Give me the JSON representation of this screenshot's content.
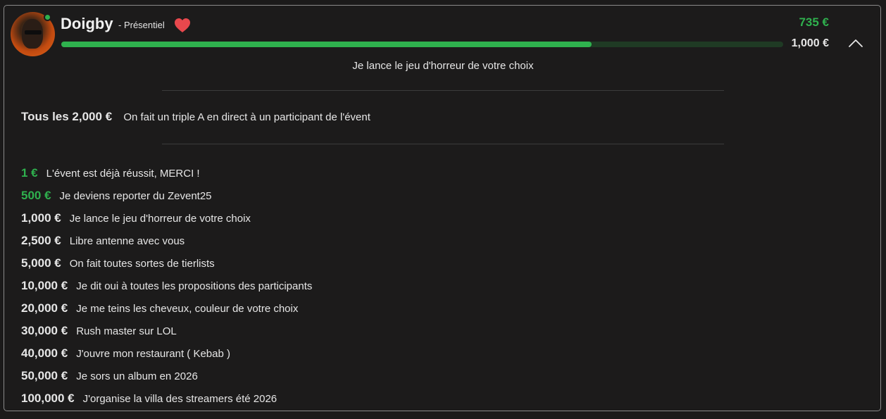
{
  "streamer": {
    "name": "Doigby",
    "mode": "- Présentiel",
    "status": "online",
    "heart_icon": "heart-icon"
  },
  "donation": {
    "raised": "735 €",
    "goal": "1,000 €",
    "progress_fraction": 0.735,
    "next_goal_text": "Je lance le jeu d'horreur de votre choix"
  },
  "recurring": {
    "amount": "Tous les 2,000 €",
    "text": "On fait un triple A en direct à un participant de l'évent"
  },
  "goals": [
    {
      "amount": "1 €",
      "text": "L'évent est déjà réussit, MERCI !",
      "reached": true
    },
    {
      "amount": "500 €",
      "text": "Je deviens reporter du Zevent25",
      "reached": true
    },
    {
      "amount": "1,000 €",
      "text": "Je lance le jeu d'horreur de votre choix",
      "reached": false
    },
    {
      "amount": "2,500 €",
      "text": "Libre antenne avec vous",
      "reached": false
    },
    {
      "amount": "5,000 €",
      "text": "On fait toutes sortes de tierlists",
      "reached": false
    },
    {
      "amount": "10,000 €",
      "text": "Je dit oui à toutes les propositions des participants",
      "reached": false
    },
    {
      "amount": "20,000 €",
      "text": "Je me teins les cheveux, couleur de votre choix",
      "reached": false
    },
    {
      "amount": "30,000 €",
      "text": "Rush master sur LOL",
      "reached": false
    },
    {
      "amount": "40,000 €",
      "text": "J'ouvre mon restaurant ( Kebab )",
      "reached": false
    },
    {
      "amount": "50,000 €",
      "text": "Je sors un album en 2026",
      "reached": false
    },
    {
      "amount": "100,000 €",
      "text": "J'organise la villa des streamers été 2026",
      "reached": false
    }
  ],
  "colors": {
    "accent_green": "#2fb14e",
    "heart": "#e8484d",
    "background": "#1c1b1b"
  }
}
